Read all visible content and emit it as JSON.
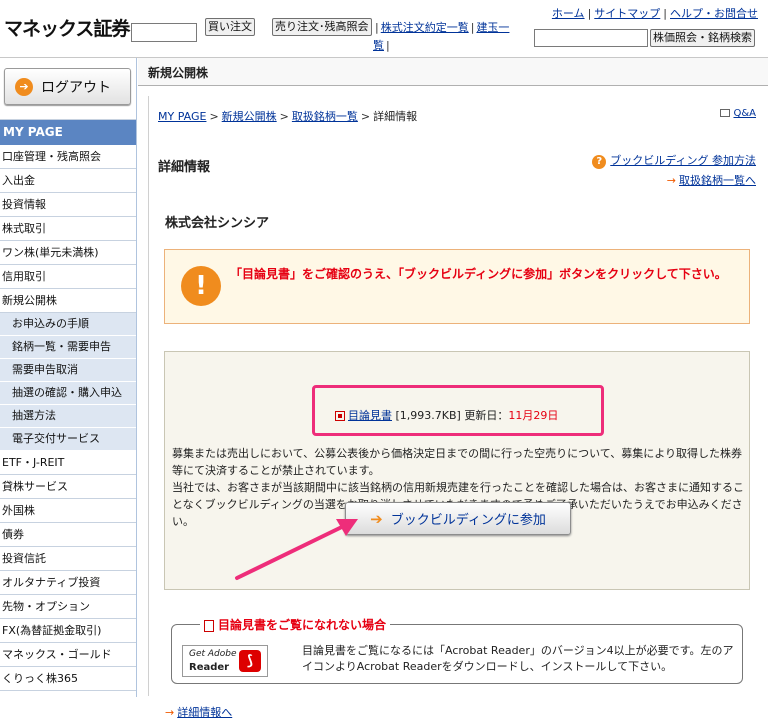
{
  "header": {
    "logo": "マネックス証券",
    "buy_label": "買い注文",
    "sell_label": "売り注文･残高照会",
    "link_orders": "株式注文約定一覧",
    "link_settle": "建玉一覧",
    "top_links": [
      "ホーム",
      "サイトマップ",
      "ヘルプ・お問合せ"
    ],
    "quote_button": "株価照会・銘柄検索"
  },
  "sidebar": {
    "logout": "ログアウト",
    "section": "MY PAGE",
    "items": [
      "口座管理・残高照会",
      "入出金",
      "投資情報",
      "株式取引",
      "ワン株(単元未満株)",
      "信用取引",
      "新規公開株"
    ],
    "sub_items": [
      "お申込みの手順",
      "銘柄一覧・需要申告",
      "需要申告取消",
      "抽選の確認・購入申込",
      "抽選方法",
      "電子交付サービス"
    ],
    "items_after": [
      "ETF・J-REIT",
      "貸株サービス",
      "外国株",
      "債券",
      "投資信託",
      "オルタナティブ投資",
      "先物・オプション",
      "FX(為替証拠金取引)",
      "マネックス・ゴールド",
      "くりっく株365"
    ]
  },
  "page": {
    "heading": "新規公開株",
    "breadcrumb": [
      "MY PAGE",
      "新規公開株",
      "取扱銘柄一覧",
      "詳細情報"
    ],
    "qa": "Q&A",
    "title": "詳細情報",
    "bb_how": "ブックビルディング 参加方法",
    "to_list": "取扱銘柄一覧へ",
    "company": "株式会社シンシア",
    "warning": "「目論見書」をご確認のうえ、「ブックビルディングに参加」ボタンをクリックして下さい。",
    "prospectus_link": "目論見書",
    "prospectus_size": "[1,993.7KB]",
    "updated_label": "更新日：",
    "updated_date": "11月29日",
    "notice_1": "募集または売出しにおいて、公募公表後から価格決定日までの間に行った空売りについて、募集により取得した株券等にて決済することが禁止されています。",
    "notice_2": "当社では、お客さまが当該期間中に該当銘柄の信用新規売建を行ったことを確認した場合は、お客さまに通知することなくブックビルディングの当選をお取り消しさせていただきますので予めご了承いただいたうえでお申込みください。",
    "bb_button": "ブックビルディングに参加",
    "reader_title": "目論見書をご覧になれない場合",
    "reader_get": "Get Adobe",
    "reader_name": "Reader",
    "reader_text": "目論見書をご覧になるには「Acrobat Reader」のバージョン4以上が必要です。左のアイコンよりAcrobat Readerをダウンロードし、インストールして下さい。",
    "more_detail": "詳細情報へ"
  }
}
